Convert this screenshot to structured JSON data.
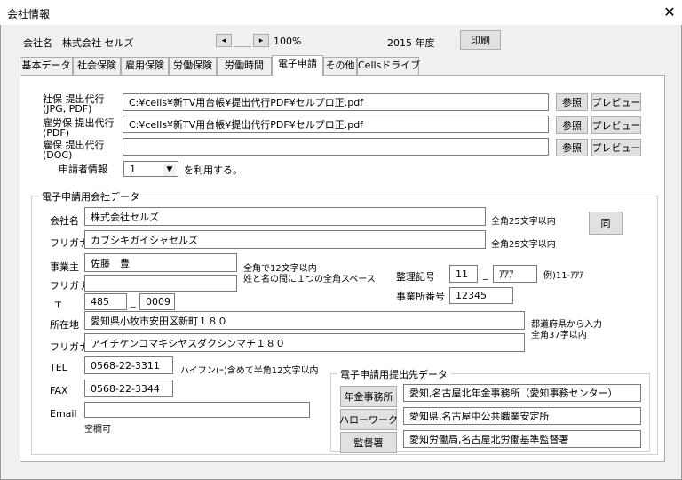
{
  "window": {
    "title": "会社情報",
    "close": "✕"
  },
  "header": {
    "company_label": "会社名",
    "company_value": "株式会社 セルズ",
    "prev_btn": "◂",
    "next_btn": "▸",
    "zoom": "100%",
    "year_label": "2015 年度",
    "print_btn": "印刷"
  },
  "tabs": [
    "基本データ",
    "社会保険",
    "雇用保険",
    "労働保険",
    "労働時間",
    "電子申請",
    "その他",
    "Cellsドライブ"
  ],
  "agency": {
    "shaho_label": "社保 提出代行",
    "shaho_sub": "(JPG, PDF)",
    "shaho_path": "C:¥cells¥新TV用台帳¥提出代行PDF¥セルプロ正.pdf",
    "rouho_label": "雇労保 提出代行",
    "rouho_sub": "(PDF)",
    "rouho_path": "C:¥cells¥新TV用台帳¥提出代行PDF¥セルプロ正.pdf",
    "koyo_label": "雇保 提出代行",
    "koyo_sub": "(DOC)",
    "koyo_path": "",
    "browse_btn": "参照",
    "preview_btn": "プレビュー",
    "applicant_label": "申請者情報",
    "applicant_value": "1",
    "applicant_suffix": "を利用する。"
  },
  "company": {
    "group_title": "電子申請用会社データ",
    "name_label": "会社名",
    "name_value": "株式会社セルズ",
    "name_note": "全角25文字以内",
    "same_btn": "同",
    "kana_label": "フリガナ",
    "kana_value": "カブシキガイシャセルズ",
    "kana_note": "全角25文字以内",
    "owner_label": "事業主",
    "owner_value": "佐藤　豊",
    "owner_note1": "全角で12文字以内",
    "owner_note2": "姓と名の間に１つの全角スペース",
    "owner_kana_label": "フリガナ",
    "owner_kana_value": "",
    "zip_label": "〒",
    "zip1": "485",
    "zip2": "0009",
    "ref_label": "整理記号",
    "ref1": "11",
    "ref2": "ｱｱｱ",
    "ref_note": "例)11-ｱｱｱ",
    "office_no_label": "事業所番号",
    "office_no_value": "12345",
    "addr_label": "所在地",
    "addr_value": "愛知県小牧市安田区新町１８０",
    "addr_note1": "都道府県から入力",
    "addr_note2": "全角37字以内",
    "addr_kana_label": "フリガナ",
    "addr_kana_value": "アイチケンコマキシヤスダクシンマチ１８０",
    "tel_label": "TEL",
    "tel_value": "0568-22-3311",
    "tel_note": "ハイフン(ｰ)含めて半角12文字以内",
    "fax_label": "FAX",
    "fax_value": "0568-22-3344",
    "email_label": "Email",
    "email_value": "",
    "email_note": "空欄可"
  },
  "destinations": {
    "group_title": "電子申請用提出先データ",
    "pension_btn": "年金事務所",
    "pension_value": "愛知,名古屋北年金事務所（愛知事務センター）",
    "hellowork_btn": "ハローワーク",
    "hellowork_value": "愛知県,名古屋中公共職業安定所",
    "labor_btn": "監督署",
    "labor_value": "愛知労働局,名古屋北労働基準監督署"
  }
}
